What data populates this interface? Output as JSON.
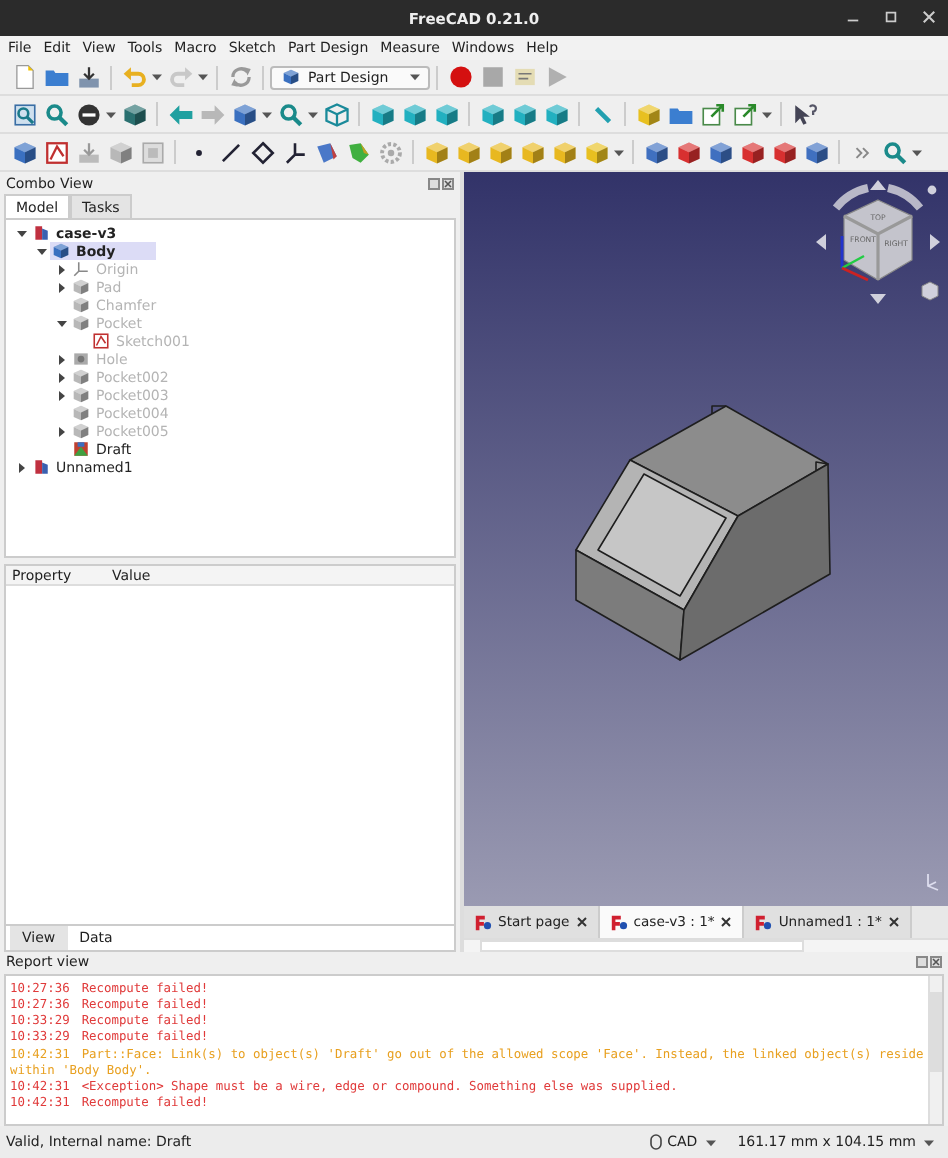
{
  "window": {
    "title": "FreeCAD 0.21.0"
  },
  "menu": [
    "File",
    "Edit",
    "View",
    "Tools",
    "Macro",
    "Sketch",
    "Part Design",
    "Measure",
    "Windows",
    "Help"
  ],
  "workbench": {
    "value": "Part Design"
  },
  "combo_view": {
    "title": "Combo View",
    "tabs": [
      {
        "label": "Model",
        "selected": true
      },
      {
        "label": "Tasks",
        "selected": false
      }
    ]
  },
  "model_tree": [
    {
      "label": "case-v3",
      "kind": "document",
      "active": true,
      "visible": true,
      "selected": false,
      "expanded": true,
      "children": [
        {
          "label": "Body",
          "kind": "body",
          "active": true,
          "visible": true,
          "selected": true,
          "expanded": true,
          "children": [
            {
              "label": "Origin",
              "kind": "origin",
              "active": false,
              "visible": false,
              "selected": false,
              "expanded": false
            },
            {
              "label": "Pad",
              "kind": "pad",
              "active": false,
              "visible": false,
              "selected": false,
              "expanded": false
            },
            {
              "label": "Chamfer",
              "kind": "pocket",
              "active": false,
              "visible": false,
              "selected": false
            },
            {
              "label": "Pocket",
              "kind": "pocket",
              "active": false,
              "visible": false,
              "selected": false,
              "expanded": true,
              "children": [
                {
                  "label": "Sketch001",
                  "kind": "sketch",
                  "active": false,
                  "visible": false,
                  "selected": false
                }
              ]
            },
            {
              "label": "Hole",
              "kind": "hole",
              "active": false,
              "visible": false,
              "selected": false,
              "expanded": false
            },
            {
              "label": "Pocket002",
              "kind": "pocket",
              "active": false,
              "visible": false,
              "selected": false,
              "expanded": false
            },
            {
              "label": "Pocket003",
              "kind": "pocket",
              "active": false,
              "visible": false,
              "selected": false,
              "expanded": false
            },
            {
              "label": "Pocket004",
              "kind": "pocket",
              "active": false,
              "visible": false,
              "selected": false
            },
            {
              "label": "Pocket005",
              "kind": "pocket",
              "active": false,
              "visible": false,
              "selected": false,
              "expanded": false
            },
            {
              "label": "Draft",
              "kind": "draft",
              "active": false,
              "visible": true,
              "selected": false
            }
          ]
        }
      ]
    },
    {
      "label": "Unnamed1",
      "kind": "document",
      "active": false,
      "visible": true,
      "selected": false,
      "expanded": false
    }
  ],
  "property_view": {
    "columns": [
      "Property",
      "Value"
    ],
    "tabs": [
      {
        "label": "View",
        "selected": false
      },
      {
        "label": "Data",
        "selected": true
      }
    ]
  },
  "nav_cube": {
    "faces": [
      "TOP",
      "FRONT",
      "RIGHT"
    ]
  },
  "document_tabs": [
    {
      "label": "Start page",
      "selected": false
    },
    {
      "label": "case-v3 : 1*",
      "selected": true
    },
    {
      "label": "Unnamed1 : 1*",
      "selected": false
    }
  ],
  "report_view": {
    "title": "Report view",
    "entries": [
      {
        "time": "10:27:36",
        "message": "Recompute failed!",
        "kind": "error"
      },
      {
        "time": "10:27:36",
        "message": "Recompute failed!",
        "kind": "error"
      },
      {
        "time": "10:33:29",
        "message": "Recompute failed!",
        "kind": "error"
      },
      {
        "time": "10:33:29",
        "message": "Recompute failed!",
        "kind": "error"
      },
      {
        "time": "10:42:31",
        "message": "Part::Face: Link(s) to object(s) 'Draft' go out of the allowed scope 'Face'. Instead, the linked object(s) reside within 'Body Body'.",
        "kind": "warning"
      },
      {
        "time": "10:42:31",
        "message": "<Exception> Shape must be a wire, edge or compound. Something else was supplied.",
        "kind": "error"
      },
      {
        "time": "10:42:31",
        "message": "Recompute failed!",
        "kind": "error"
      }
    ]
  },
  "status_bar": {
    "message": "Valid, Internal name: Draft",
    "navigation": "CAD",
    "dimensions": "161.17 mm x 104.15 mm"
  }
}
